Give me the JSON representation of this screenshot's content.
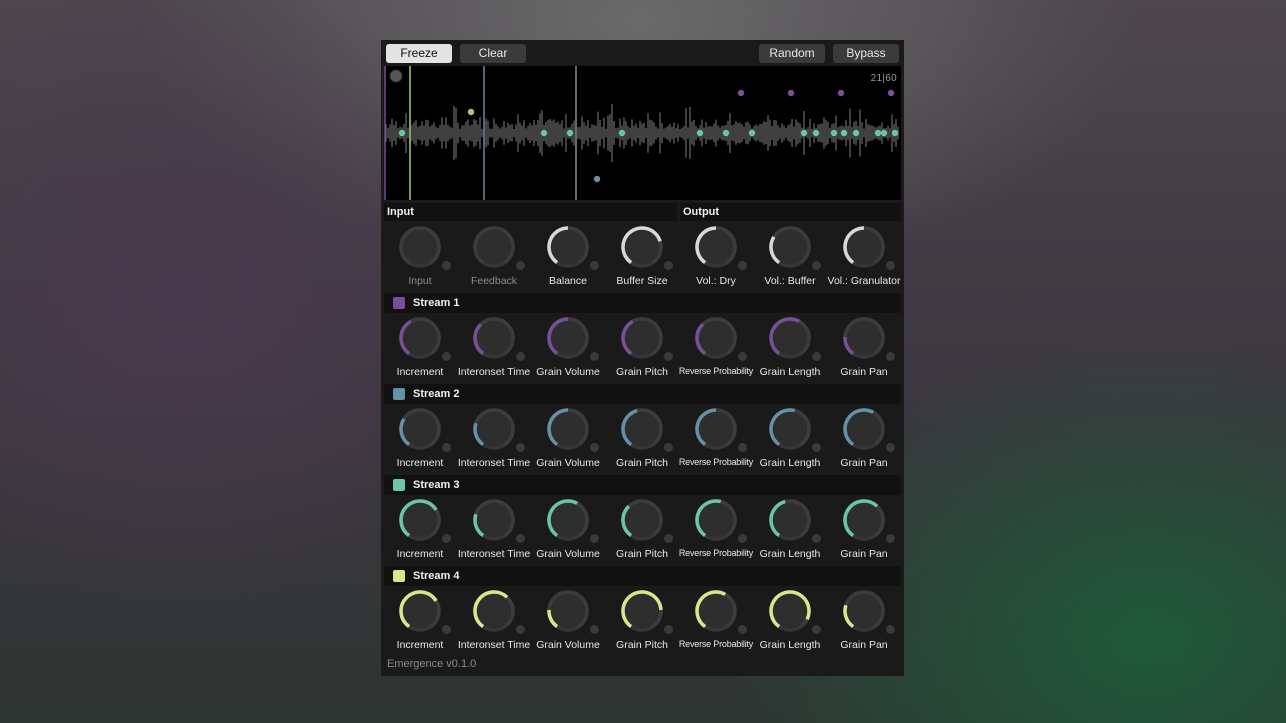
{
  "toolbar": {
    "freeze_label": "Freeze",
    "clear_label": "Clear",
    "random_label": "Random",
    "bypass_label": "Bypass"
  },
  "display": {
    "counter": "21|60"
  },
  "sections": {
    "input_label": "Input",
    "output_label": "Output"
  },
  "global_knobs": [
    {
      "label": "Input",
      "value": 0.0,
      "dim": true,
      "color": "#5a5a5a"
    },
    {
      "label": "Feedback",
      "value": 0.0,
      "dim": true,
      "color": "#5a5a5a"
    },
    {
      "label": "Balance",
      "value": 0.5,
      "dim": false,
      "color": "#d8d8d8"
    },
    {
      "label": "Buffer Size",
      "value": 0.75,
      "dim": false,
      "color": "#d8d8d8"
    },
    {
      "label": "Vol.: Dry",
      "value": 0.5,
      "dim": false,
      "color": "#d8d8d8"
    },
    {
      "label": "Vol.: Buffer",
      "value": 0.3,
      "dim": false,
      "color": "#d8d8d8"
    },
    {
      "label": "Vol.: Granulator",
      "value": 0.5,
      "dim": false,
      "color": "#d8d8d8"
    }
  ],
  "param_labels": [
    "Increment",
    "Interonset Time",
    "Grain Volume",
    "Grain Pitch",
    "Reverse Probability",
    "Grain Length",
    "Grain Pan"
  ],
  "streams": [
    {
      "title": "Stream 1",
      "color": "#7a4f99",
      "values": [
        0.4,
        0.35,
        0.5,
        0.4,
        0.35,
        0.6,
        0.2
      ]
    },
    {
      "title": "Stream 2",
      "color": "#6490a8",
      "values": [
        0.3,
        0.25,
        0.5,
        0.45,
        0.5,
        0.55,
        0.6
      ]
    },
    {
      "title": "Stream 3",
      "color": "#6ac7a2",
      "values": [
        0.7,
        0.25,
        0.6,
        0.35,
        0.55,
        0.45,
        0.65
      ]
    },
    {
      "title": "Stream 4",
      "color": "#d5e98a",
      "values": [
        0.7,
        0.65,
        0.2,
        0.8,
        0.6,
        0.9,
        0.25
      ]
    }
  ],
  "footer": {
    "version": "Emergence v0.1.0"
  }
}
